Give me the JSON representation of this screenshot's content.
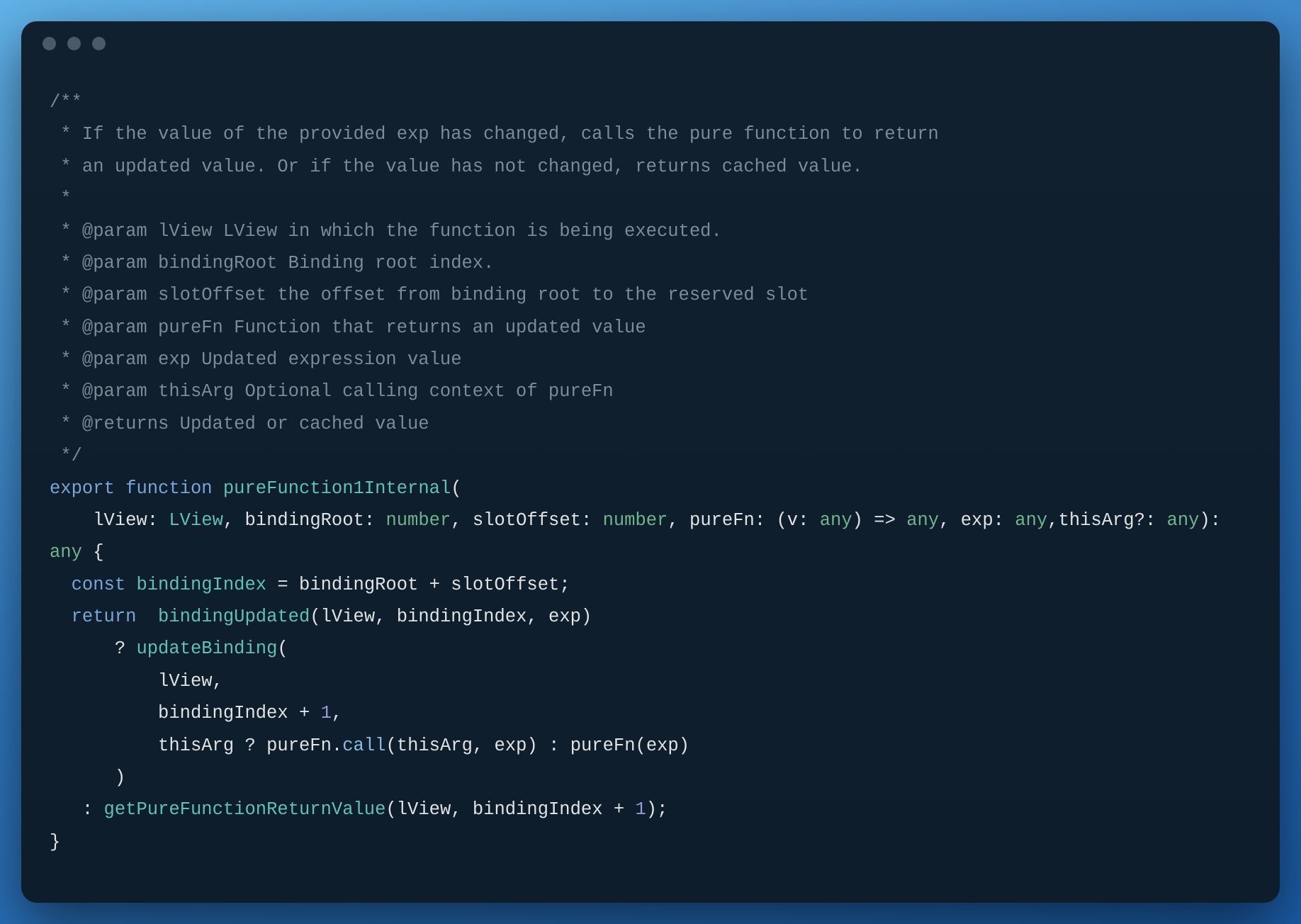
{
  "window": {
    "traffic_dots": 3
  },
  "code": {
    "comment": {
      "l1": "/**",
      "l2": " * If the value of the provided exp has changed, calls the pure function to return",
      "l3": " * an updated value. Or if the value has not changed, returns cached value.",
      "l4": " *",
      "l5": " * @param lView LView in which the function is being executed.",
      "l6": " * @param bindingRoot Binding root index.",
      "l7": " * @param slotOffset the offset from binding root to the reserved slot",
      "l8": " * @param pureFn Function that returns an updated value",
      "l9": " * @param exp Updated expression value",
      "l10": " * @param thisArg Optional calling context of pureFn",
      "l11": " * @returns Updated or cached value",
      "l12": " */"
    },
    "kw_export": "export",
    "kw_function": "function",
    "fn_name": "pureFunction1Internal",
    "params": {
      "lView": "lView",
      "LView_type": "LView",
      "bindingRoot": "bindingRoot",
      "number": "number",
      "slotOffset": "slotOffset",
      "pureFn": "pureFn",
      "v": "v",
      "any": "any",
      "arrow": "=>",
      "exp": "exp",
      "thisArgOpt": "thisArg?",
      "thisArg": "thisArg"
    },
    "kw_const": "const",
    "bindingIndex": "bindingIndex",
    "kw_return": "return",
    "bindingUpdated": "bindingUpdated",
    "updateBinding": "updateBinding",
    "call_prop": "call",
    "getPureFunctionReturnValue": "getPureFunctionReturnValue",
    "num_one_a": "1",
    "num_one_b": "1",
    "sym": {
      "open_paren": "(",
      "close_paren": ")",
      "colon": ":",
      "comma": ",",
      "open_brace": "{",
      "close_brace": "}",
      "eq": "=",
      "plus": "+",
      "semicolon": ";",
      "qmark": "?",
      "ternary_colon": ":",
      "dot": "."
    },
    "indent4": "    ",
    "indent2": "  ",
    "indent5": "     ",
    "indent6": "      ",
    "indent10": "          ",
    "indent3": "   "
  }
}
